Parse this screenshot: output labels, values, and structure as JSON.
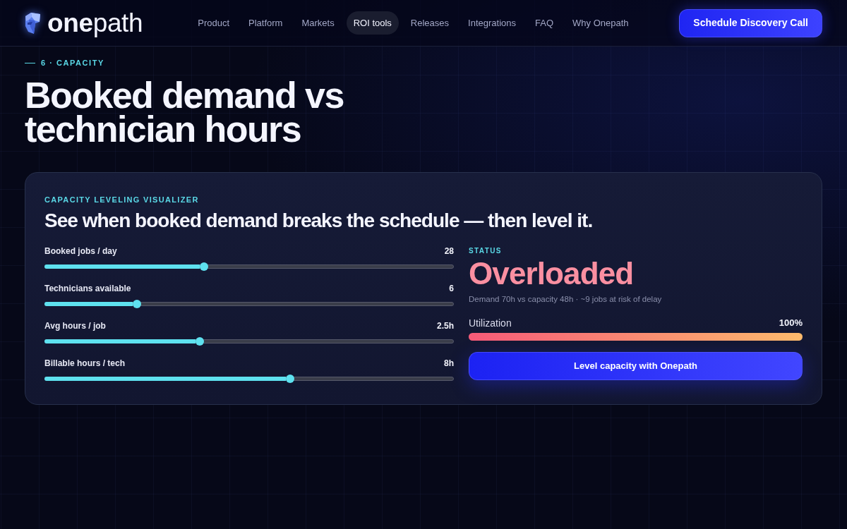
{
  "nav": {
    "logo": "**one**path",
    "links": [
      {
        "label": "Product",
        "selected": false
      },
      {
        "label": "Platform",
        "selected": false
      },
      {
        "label": "Markets",
        "selected": false
      },
      {
        "label": "ROI tools",
        "selected": true
      },
      {
        "label": "Releases",
        "selected": false
      },
      {
        "label": "Integrations",
        "selected": false
      },
      {
        "label": "FAQ",
        "selected": false
      },
      {
        "label": "Why Onepath",
        "selected": false
      }
    ],
    "cta": "Schedule Discovery Call"
  },
  "hero": {
    "eyebrow": "6 · CAPACITY",
    "title": "Booked demand vs technician hours"
  },
  "visualizer": {
    "eyebrow": "CAPACITY LEVELING VISUALIZER",
    "headline": "See when booked demand breaks the schedule — then level it.",
    "sliders": [
      {
        "label": "Booked jobs / day",
        "value": "28",
        "level": 0.39
      },
      {
        "label": "Technicians available",
        "value": "6",
        "level": 0.225
      },
      {
        "label": "Avg hours / job",
        "value": "2.5h",
        "level": 0.38
      },
      {
        "label": "Billable hours / tech",
        "value": "8h",
        "level": 0.6
      }
    ],
    "status": {
      "label": "STATUS",
      "value": "Overloaded",
      "detail": "Demand 70h vs capacity 48h · ~9 jobs at risk of delay"
    },
    "utilization": {
      "label": "Utilization",
      "reading": "100%",
      "level": 1
    },
    "button": "Level capacity with Onepath"
  }
}
